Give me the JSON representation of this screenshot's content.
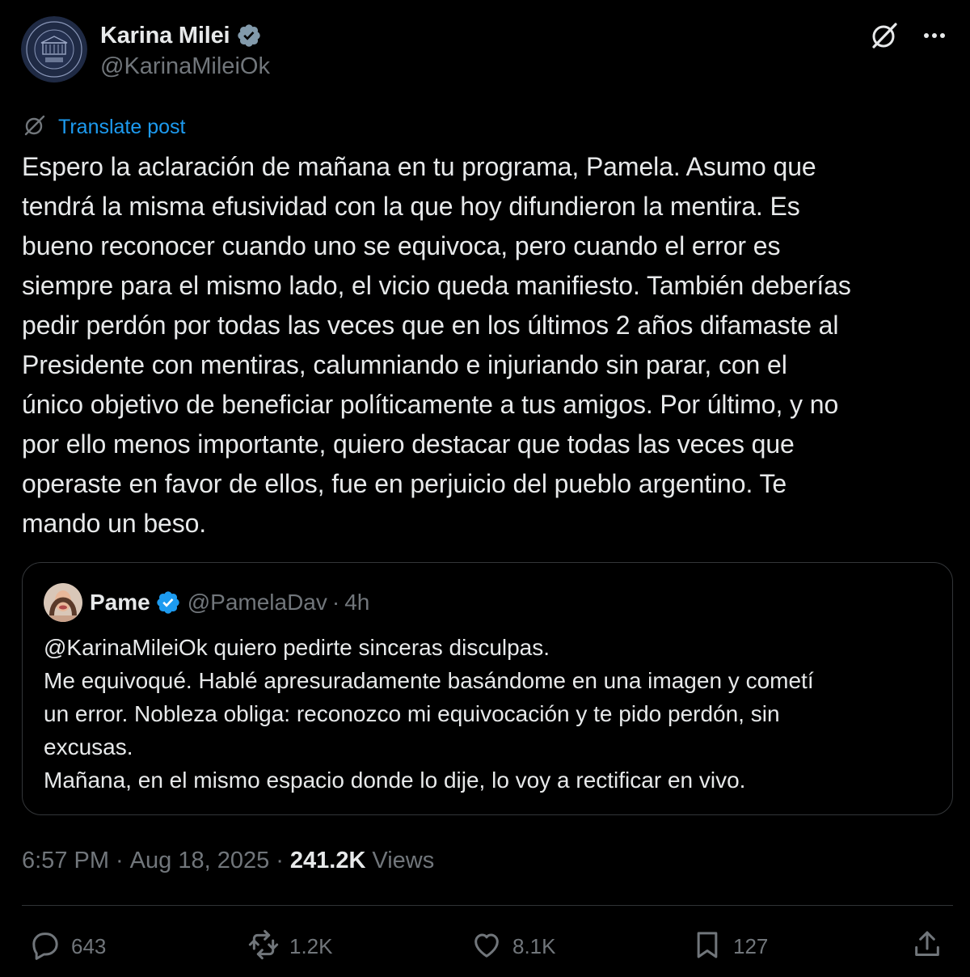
{
  "author": {
    "name": "Karina Milei",
    "handle": "@KarinaMileiOk"
  },
  "translate_label": "Translate post",
  "post_text": "Espero la aclaración de mañana en tu programa, Pamela. Asumo que\ntendrá la misma efusividad con la que hoy difundieron la mentira. Es\nbueno reconocer cuando uno se equivoca, pero cuando el error es\nsiempre para el mismo lado, el vicio queda manifiesto. También deberías\npedir perdón por todas las veces que en los últimos 2 años difamaste al\nPresidente con mentiras, calumniando e injuriando sin parar, con el\núnico objetivo de beneficiar políticamente a tus amigos. Por último, y no\npor ello menos importante, quiero destacar que todas las veces que\noperaste en favor de ellos, fue en perjuicio del pueblo argentino. Te\nmando un beso.",
  "quote": {
    "name": "Pame",
    "handle": "@PamelaDav",
    "dot": "·",
    "time": "4h",
    "text": "@KarinaMileiOk quiero pedirte sinceras disculpas.\nMe equivoqué. Hablé apresuradamente basándome en una imagen y cometí\nun error. Nobleza obliga: reconozco mi equivocación y te pido perdón, sin\nexcusas.\nMañana, en el mismo espacio donde lo dije, lo voy a rectificar en vivo."
  },
  "meta": {
    "time": "6:57 PM",
    "sep1": "·",
    "date": "Aug 18, 2025",
    "sep2": "·",
    "views_count": "241.2K",
    "views_label": "Views"
  },
  "actions": {
    "replies": "643",
    "reposts": "1.2K",
    "likes": "8.1K",
    "bookmarks": "127"
  },
  "icons": {
    "verified": "verified-badge-icon",
    "grok": "grok-icon",
    "more": "more-icon",
    "reply": "reply-icon",
    "repost": "repost-icon",
    "like": "heart-icon",
    "bookmark": "bookmark-icon",
    "share": "share-icon"
  },
  "colors": {
    "background": "#000000",
    "text": "#e7e9ea",
    "secondary": "#71767b",
    "link": "#1d9bf0",
    "border": "#2f3336"
  }
}
